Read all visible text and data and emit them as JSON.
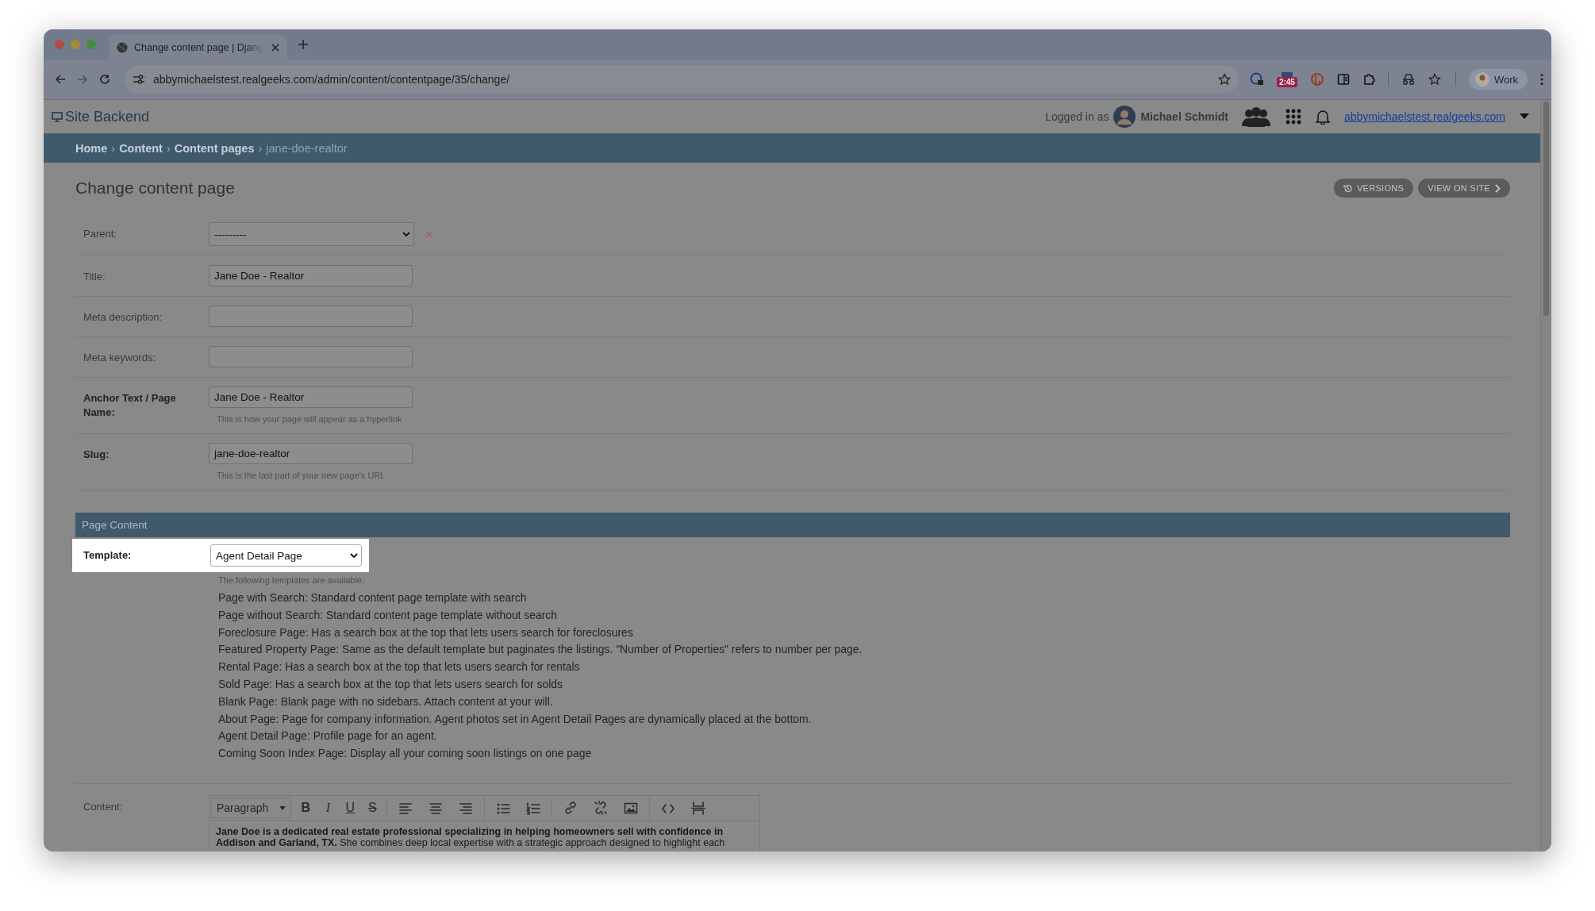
{
  "browser": {
    "tab_title": "Change content page | Djang",
    "url": "abbymichaelstest.realgeeks.com/admin/content/contentpage/35/change/",
    "extension_badge": "2:45",
    "profile": "Work"
  },
  "header": {
    "site_title": "Site Backend",
    "logged_in_label": "Logged in as",
    "user_name": "Michael Schmidt",
    "site_link": "abbymichaelstest.realgeeks.com"
  },
  "breadcrumbs": [
    {
      "label": "Home",
      "current": false
    },
    {
      "separator": "›",
      "label": "Content",
      "current": false
    },
    {
      "separator": "›",
      "label": "Content pages",
      "current": false
    },
    {
      "separator": "›",
      "label": "jane-doe-realtor",
      "current": true
    }
  ],
  "page_title": "Change content page",
  "actions": [
    {
      "kind": "versions",
      "label": "VERSIONS"
    },
    {
      "kind": "view",
      "label": "VIEW ON SITE"
    }
  ],
  "fields": [
    {
      "kind": "select",
      "label": "Parent:",
      "value": "---------",
      "required": false
    },
    {
      "kind": "text",
      "label": "Title:",
      "value": "Jane Doe - Realtor",
      "required": false
    },
    {
      "kind": "text",
      "label": "Meta description:",
      "required": false
    },
    {
      "kind": "text",
      "label": "Meta keywords:",
      "required": false
    },
    {
      "kind": "text",
      "label": "Anchor Text / Page Name:",
      "value": "Jane Doe - Realtor",
      "required": true,
      "help": "This is how your page will appear as a hyperlink"
    },
    {
      "kind": "text",
      "label": "Slug:",
      "value": "jane-doe-realtor",
      "required": true,
      "help": "This is the last part of your new page's URL"
    }
  ],
  "section": {
    "title": "Page Content",
    "template": {
      "label": "Template:",
      "value": "Agent Detail Page",
      "highlighted": true,
      "help": "The following templates are available:",
      "options": [
        "Page with Search: Standard content page template with search",
        "Page without Search: Standard content page template without search",
        "Foreclosure Page: Has a search box at the top that lets users search for foreclosures",
        "Featured Property Page: Same as the default template but paginates the listings. \"Number of Properties\" refers to number per page.",
        "Rental Page: Has a search box at the top that lets users search for rentals",
        "Sold Page: Has a search box at the top that lets users search for solds",
        "Blank Page: Blank page with no sidebars. Attach content at your will.",
        "About Page: Page for company information. Agent photos set in Agent Detail Pages are dynamically placed at the bottom.",
        "Agent Detail Page: Profile page for an agent.",
        "Coming Soon Index Page: Display all your coming soon listings on one page"
      ]
    },
    "content": {
      "label": "Content:",
      "toolbar": [
        [
          {
            "kind": "dropdown",
            "label": "Paragraph"
          },
          {
            "kind": "bold",
            "label": "B"
          },
          {
            "kind": "italic",
            "label": "I"
          },
          {
            "kind": "underline",
            "label": "U"
          },
          {
            "kind": "strike",
            "label": "S"
          }
        ],
        [
          {
            "kind": "align-left"
          },
          {
            "kind": "align-center"
          },
          {
            "kind": "align-right"
          }
        ],
        [
          {
            "kind": "bullet-list"
          },
          {
            "kind": "number-list"
          }
        ],
        [
          {
            "kind": "link"
          },
          {
            "kind": "unlink"
          },
          {
            "kind": "image"
          }
        ],
        [
          {
            "kind": "code"
          },
          {
            "kind": "page-break"
          }
        ]
      ],
      "text": "**Jane Doe is a dedicated real estate professional specializing in helping homeowners sell with confidence in Addison and Garland, TX.** She combines deep local expertise with a strategic approach designed to highlight each"
    }
  }
}
